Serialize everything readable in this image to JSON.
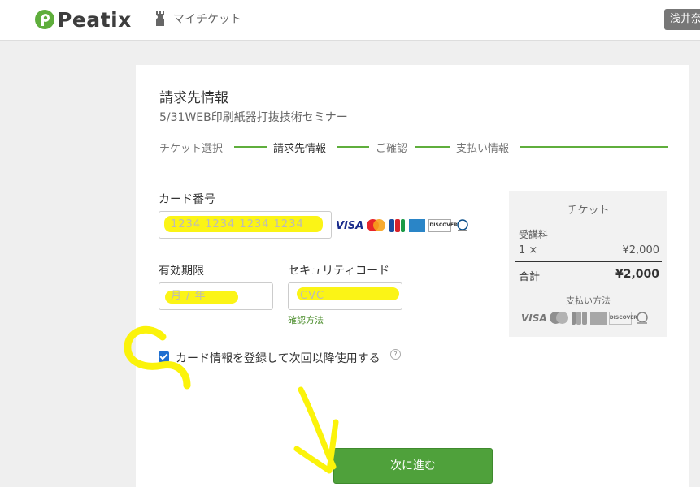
{
  "header": {
    "logo_text": "Peatix",
    "my_ticket_label": "マイチケット",
    "user_name": "浅井奈"
  },
  "page": {
    "title": "請求先情報",
    "subtitle": "5/31WEB印刷紙器打抜技術セミナー"
  },
  "steps": [
    {
      "label": "チケット選択",
      "current": false
    },
    {
      "label": "請求先情報",
      "current": true
    },
    {
      "label": "ご確認",
      "current": false
    },
    {
      "label": "支払い情報",
      "current": false
    }
  ],
  "form": {
    "card_number_label": "カード番号",
    "card_number_placeholder": "1234 1234 1234 1234",
    "expiry_label": "有効期限",
    "expiry_placeholder": "月 / 年",
    "cvc_label": "セキュリティコード",
    "cvc_placeholder": "CVC",
    "cvc_help_link": "確認方法",
    "save_card_label": "カード情報を登録して次回以降使用する",
    "save_card_checked": true,
    "help_icon": "?",
    "brands": [
      "VISA",
      "mastercard",
      "JCB",
      "AMEX",
      "DISCOVER",
      "Diners Club"
    ],
    "discover_text": "DISCOVER"
  },
  "summary": {
    "title": "チケット",
    "item_name": "受講料",
    "quantity": "1 ×",
    "price": "¥2,000",
    "total_label": "合計",
    "total_value": "¥2,000",
    "payment_methods_label": "支払い方法"
  },
  "actions": {
    "next_label": "次に進む"
  },
  "colors": {
    "accent_green": "#4fa13b",
    "highlight_yellow": "#fbf30a",
    "visa_blue": "#1a2c8c"
  }
}
